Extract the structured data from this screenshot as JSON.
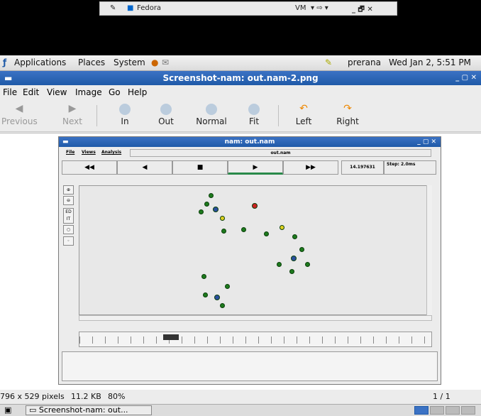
{
  "vm_bar": {
    "title": "Fedora",
    "vm_label": "VM"
  },
  "panel": {
    "apps": "Applications",
    "places": "Places",
    "system": "System",
    "user": "prerana",
    "datetime": "Wed Jan 2, 5:51 PM"
  },
  "window": {
    "title": "Screenshot-nam: out.nam-2.png",
    "menu": [
      "File",
      "Edit",
      "View",
      "Image",
      "Go",
      "Help"
    ],
    "toolbar": {
      "previous": "Previous",
      "next": "Next",
      "zoom_in": "In",
      "zoom_out": "Out",
      "normal": "Normal",
      "fit": "Fit",
      "left": "Left",
      "right": "Right"
    },
    "status": {
      "dims": "796 x 529 pixels",
      "size": "11.2 KB",
      "zoom": "80%",
      "page": "1 / 1"
    },
    "taskbar_item": "Screenshot-nam: out..."
  },
  "nam": {
    "title": "nam: out.nam",
    "menu": [
      "File",
      "Views",
      "Analysis"
    ],
    "filename": "out.nam",
    "controls": [
      "◀◀",
      "◀",
      "■",
      "▶",
      "▶▶"
    ],
    "time": "14.197631",
    "step": "Step: 2.0ms",
    "side_edit": "ED IT"
  },
  "colors": {
    "accent": "#1f5aa8",
    "node_green": "#1d7a1d",
    "node_blue": "#2a4f9f",
    "node_red": "#cc2222",
    "node_yellow": "#e0d020"
  }
}
